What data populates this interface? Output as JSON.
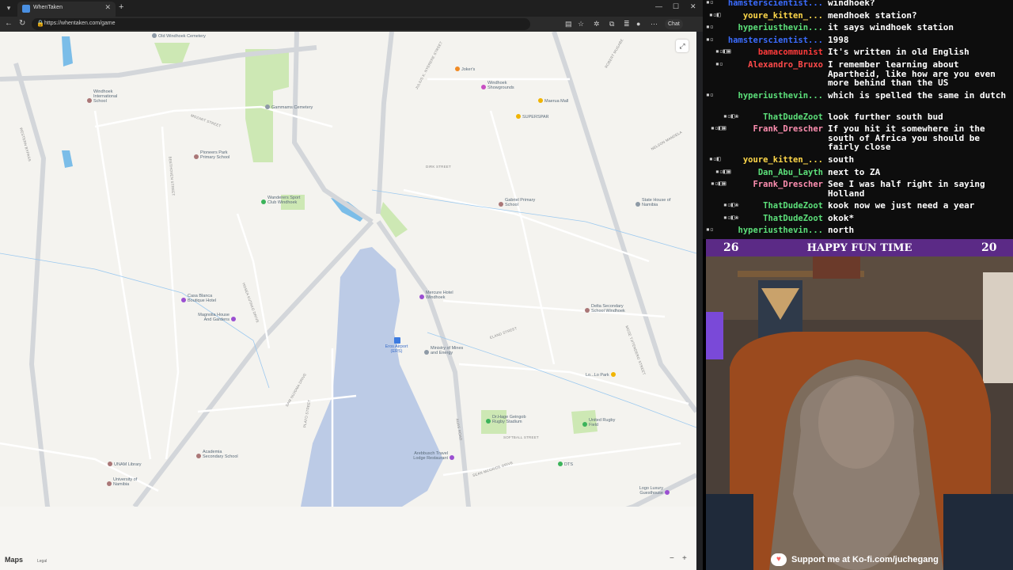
{
  "browser": {
    "tab_title": "WhenTaken",
    "url": "https://whentaken.com/game",
    "chat_button": "Chat"
  },
  "map": {
    "attribution_logo": "Maps",
    "legal": "Legal",
    "zoom_out": "−",
    "zoom_in": "+",
    "pois": [
      {
        "label": "Old Windhoek Cemetery",
        "color": "#8e9aa6"
      },
      {
        "label": "Joker's",
        "color": "#f08a24"
      },
      {
        "label": "Windhoek Showgrounds",
        "color": "#c84fc2"
      },
      {
        "label": "Windhoek International School",
        "color": "#a77"
      },
      {
        "label": "Gammams Cemetery",
        "color": "#8e9aa6"
      },
      {
        "label": "Maerua Mall",
        "color": "#f0b400"
      },
      {
        "label": "SUPERSPAR",
        "color": "#f0b400"
      },
      {
        "label": "Pioneers Park Primary School",
        "color": "#a77"
      },
      {
        "label": "Wanderers Sport Club Windhoek",
        "color": "#3bb35a"
      },
      {
        "label": "Gabriel Primary School",
        "color": "#a77"
      },
      {
        "label": "State House of Namibia",
        "color": "#8e9aa6"
      },
      {
        "label": "Casa Blanca Boutique Hotel",
        "color": "#9b4fd1"
      },
      {
        "label": "Mercure Hotel Windhoek",
        "color": "#9b4fd1"
      },
      {
        "label": "Magnolia House And Gardens",
        "color": "#9b4fd1"
      },
      {
        "label": "Delta Secondary School Windhoek",
        "color": "#a77"
      },
      {
        "label": "Eros Airport (ERS)",
        "color": "#3d7be0"
      },
      {
        "label": "Ministry of Mines and Energy",
        "color": "#8e9aa6"
      },
      {
        "label": "Lo...Lo Park",
        "color": "#f0b400"
      },
      {
        "label": "Dr.Hage Geingob Rugby Stadium",
        "color": "#3bb35a"
      },
      {
        "label": "United Rugby Field",
        "color": "#3bb35a"
      },
      {
        "label": "Academia Secondary School",
        "color": "#a77"
      },
      {
        "label": "Arebbusch Travel Lodge Restaurant",
        "color": "#9b4fd1"
      },
      {
        "label": "DTS",
        "color": "#3bb35a"
      },
      {
        "label": "UNAM Library",
        "color": "#a77"
      },
      {
        "label": "University of Namibia",
        "color": "#a77"
      },
      {
        "label": "Logo Luxury Guesthouse",
        "color": "#9b4fd1"
      }
    ],
    "streets": [
      "JULIUS K. NYERERE STREET",
      "SAM NUJOMA DRIVE",
      "AUAS ROAD",
      "SEAN MCGRIDE DRIVE",
      "HOSEA KUTAKO DRIVE",
      "PLATO STREET",
      "BEETHOVEN STREET",
      "MOZART STREET",
      "NELSON MANDELA",
      "ROBERT MUGABE",
      "WESTERN BYPASS",
      "ELAND STREET",
      "MOSE TJITENDERO STREET",
      "SOFTBALL STREET",
      "DIRK STREET"
    ]
  },
  "chat": {
    "messages": [
      {
        "user": "hamsterscientist...",
        "color": "#3b6cff",
        "badges": "▪▫",
        "text": "windhoek?"
      },
      {
        "user": "youre_kitten_...",
        "color": "#ffd84a",
        "badges": "▪▫◧",
        "text": "mendhoek station?"
      },
      {
        "user": "hyperiusthevin...",
        "color": "#5ce07a",
        "badges": "▪▫",
        "text": "it says windhoek station"
      },
      {
        "user": "hamsterscientist...",
        "color": "#3b6cff",
        "badges": "▪▫",
        "text": "1998"
      },
      {
        "user": "bamacommunist",
        "color": "#ff3b3b",
        "badges": "▪▫◧▣",
        "text": "It's written in old English"
      },
      {
        "user": "Alexandro_Bruxo",
        "color": "#ff4a4a",
        "badges": "▪▫",
        "text": "I remember learning about Apartheid, like how are you even more behind than the US"
      },
      {
        "user": "hyperiusthevin...",
        "color": "#5ce07a",
        "badges": "▪▫",
        "text": "which is spelled the same in dutch"
      },
      {
        "user": "ThatDudeZoot",
        "color": "#5ce07a",
        "badges": "▪▫◧❀",
        "text": "look further south bud"
      },
      {
        "user": "Frank_Drescher",
        "color": "#ff8fb1",
        "badges": "▪▫◧▣",
        "text": "If you hit it somewhere in the south of Africa you should be fairly close"
      },
      {
        "user": "youre_kitten_...",
        "color": "#ffd84a",
        "badges": "▪▫◧",
        "text": "south"
      },
      {
        "user": "Dan_Abu_Layth",
        "color": "#5ce07a",
        "badges": "▪▫◧▣",
        "text": "next to ZA"
      },
      {
        "user": "Frank_Drescher",
        "color": "#ff8fb1",
        "badges": "▪▫◧▣",
        "text": "See I was half right in saying Holland"
      },
      {
        "user": "ThatDudeZoot",
        "color": "#5ce07a",
        "badges": "▪▫◧❀",
        "text": "kook now we just need a year"
      },
      {
        "user": "ThatDudeZoot",
        "color": "#5ce07a",
        "badges": "▪▫◧❀",
        "text": "okok*"
      },
      {
        "user": "hyperiusthevin...",
        "color": "#5ce07a",
        "badges": "▪▫",
        "text": "north"
      }
    ]
  },
  "overlay": {
    "left_number": "26",
    "title": "HAPPY FUN TIME",
    "right_number": "20",
    "kofi_text": "Support me at Ko-fi.com/juchegang"
  }
}
